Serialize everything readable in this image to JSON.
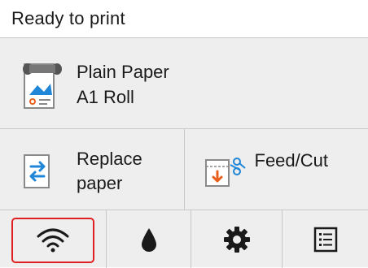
{
  "status": {
    "text": "Ready to print"
  },
  "paper": {
    "type": "Plain Paper",
    "size": "A1 Roll",
    "icon": "paper-roll-icon"
  },
  "actions": {
    "replace_paper": {
      "line1": "Replace",
      "line2": "paper",
      "icon": "replace-paper-icon"
    },
    "feed_cut": {
      "label": "Feed/Cut",
      "icon": "feed-cut-icon"
    }
  },
  "bottom_nav": [
    {
      "name": "wifi",
      "icon": "wifi-icon",
      "selected": true
    },
    {
      "name": "ink",
      "icon": "ink-drop-icon",
      "selected": false
    },
    {
      "name": "settings",
      "icon": "gear-icon",
      "selected": false
    },
    {
      "name": "list",
      "icon": "list-icon",
      "selected": false
    }
  ],
  "colors": {
    "accent_blue": "#1f86d8",
    "selected_border": "#e02020",
    "panel_bg": "#eeeeee",
    "arrow_orange": "#e8601c"
  }
}
